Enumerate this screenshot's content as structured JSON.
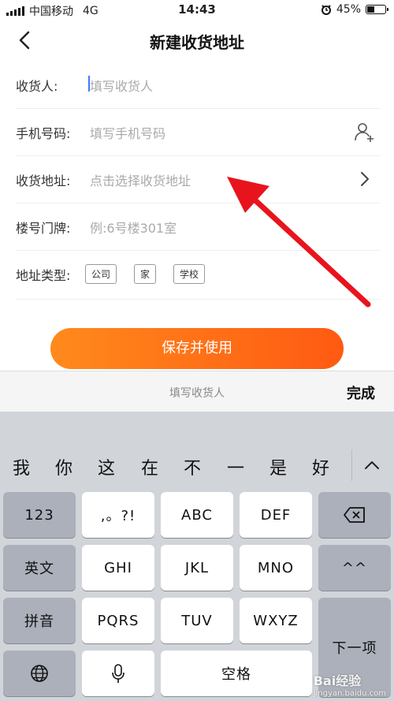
{
  "status": {
    "carrier": "中国移动",
    "network": "4G",
    "time": "14:43",
    "battery": "45%",
    "battery_level": 0.45
  },
  "nav": {
    "title": "新建收货地址"
  },
  "form": {
    "recipient": {
      "label": "收货人:",
      "placeholder": "填写收货人"
    },
    "phone": {
      "label": "手机号码:",
      "placeholder": "填写手机号码"
    },
    "address": {
      "label": "收货地址:",
      "placeholder": "点击选择收货地址"
    },
    "building": {
      "label": "楼号门牌:",
      "placeholder": "例:6号楼301室"
    },
    "type": {
      "label": "地址类型:",
      "options": [
        "公司",
        "家",
        "学校"
      ]
    }
  },
  "save_button": "保存并使用",
  "accessory": {
    "placeholder": "填写收货人",
    "done": "完成"
  },
  "keyboard": {
    "candidates": [
      "我",
      "你",
      "这",
      "在",
      "不",
      "一",
      "是",
      "好"
    ],
    "keys": {
      "num": "123",
      "punct": ",。?!",
      "abc": "ABC",
      "def": "DEF",
      "en": "英文",
      "ghi": "GHI",
      "jkl": "JKL",
      "mno": "MNO",
      "face": "^^",
      "pinyin": "拼音",
      "pqrs": "PQRS",
      "tuv": "TUV",
      "wxyz": "WXYZ",
      "next": "下一项",
      "space": "空格"
    }
  },
  "watermark": {
    "brand": "Bai经验",
    "url": "jingyan.baidu.com"
  },
  "colors": {
    "accent_start": "#ff8a1c",
    "accent_end": "#ff5a12",
    "arrow": "#e8141d",
    "cursor": "#3a7bff"
  }
}
